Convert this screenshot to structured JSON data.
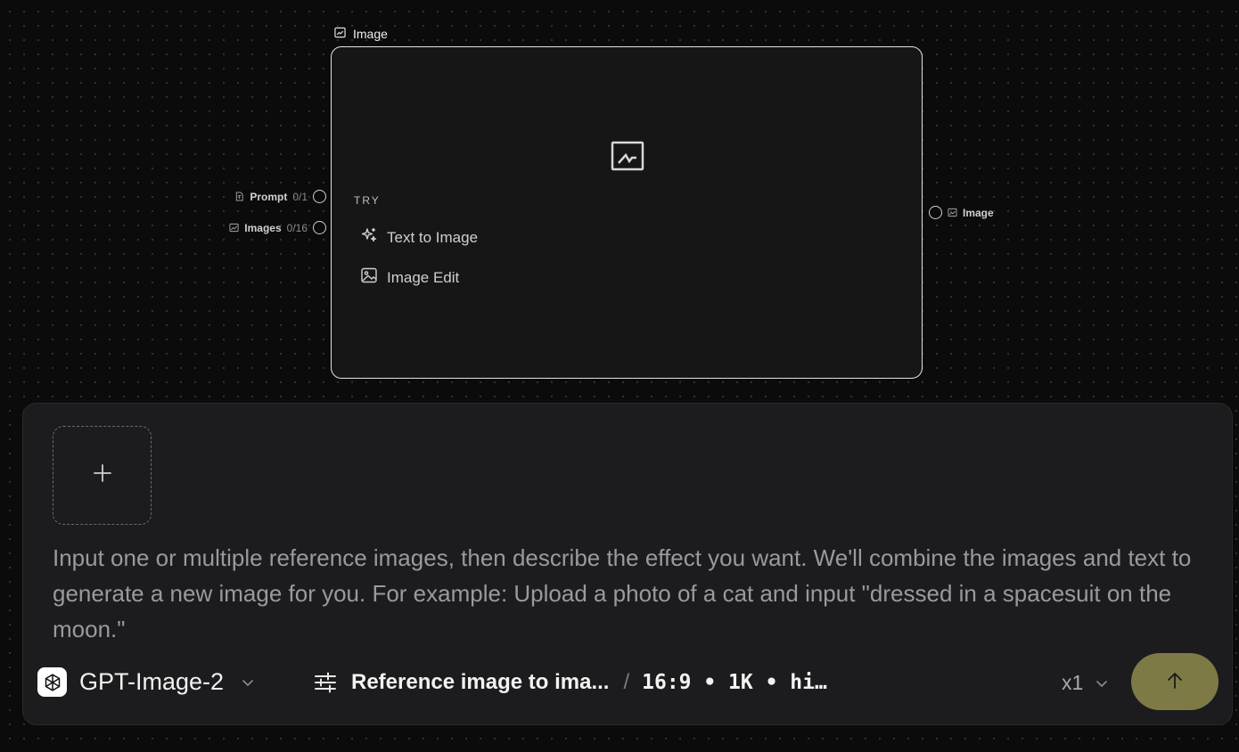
{
  "node": {
    "title": "Image",
    "try_label": "TRY",
    "try_items": [
      {
        "label": "Text to Image",
        "icon": "sparkles-icon"
      },
      {
        "label": "Image Edit",
        "icon": "image-icon"
      }
    ]
  },
  "ports": {
    "inputs": [
      {
        "label": "Prompt",
        "count": "0/1",
        "icon": "text-file-icon"
      },
      {
        "label": "Images",
        "count": "0/16",
        "icon": "image-icon"
      }
    ],
    "output": {
      "label": "Image",
      "icon": "image-icon"
    }
  },
  "composer": {
    "placeholder": "Input one or multiple reference images, then describe the effect you want. We'll combine the images and text to generate a new image for you. For example: Upload a photo of a cat and input \"dressed in a spacesuit on the moon.\"",
    "model_name": "GPT-Image-2",
    "mode_label": "Reference image to ima...",
    "separator": "/",
    "params": "16:9 • 1K • hi…",
    "count": "x1"
  },
  "colors": {
    "background": "#0b0b0b",
    "panel": "#1c1c1e",
    "send_button": "#7d7a46"
  }
}
